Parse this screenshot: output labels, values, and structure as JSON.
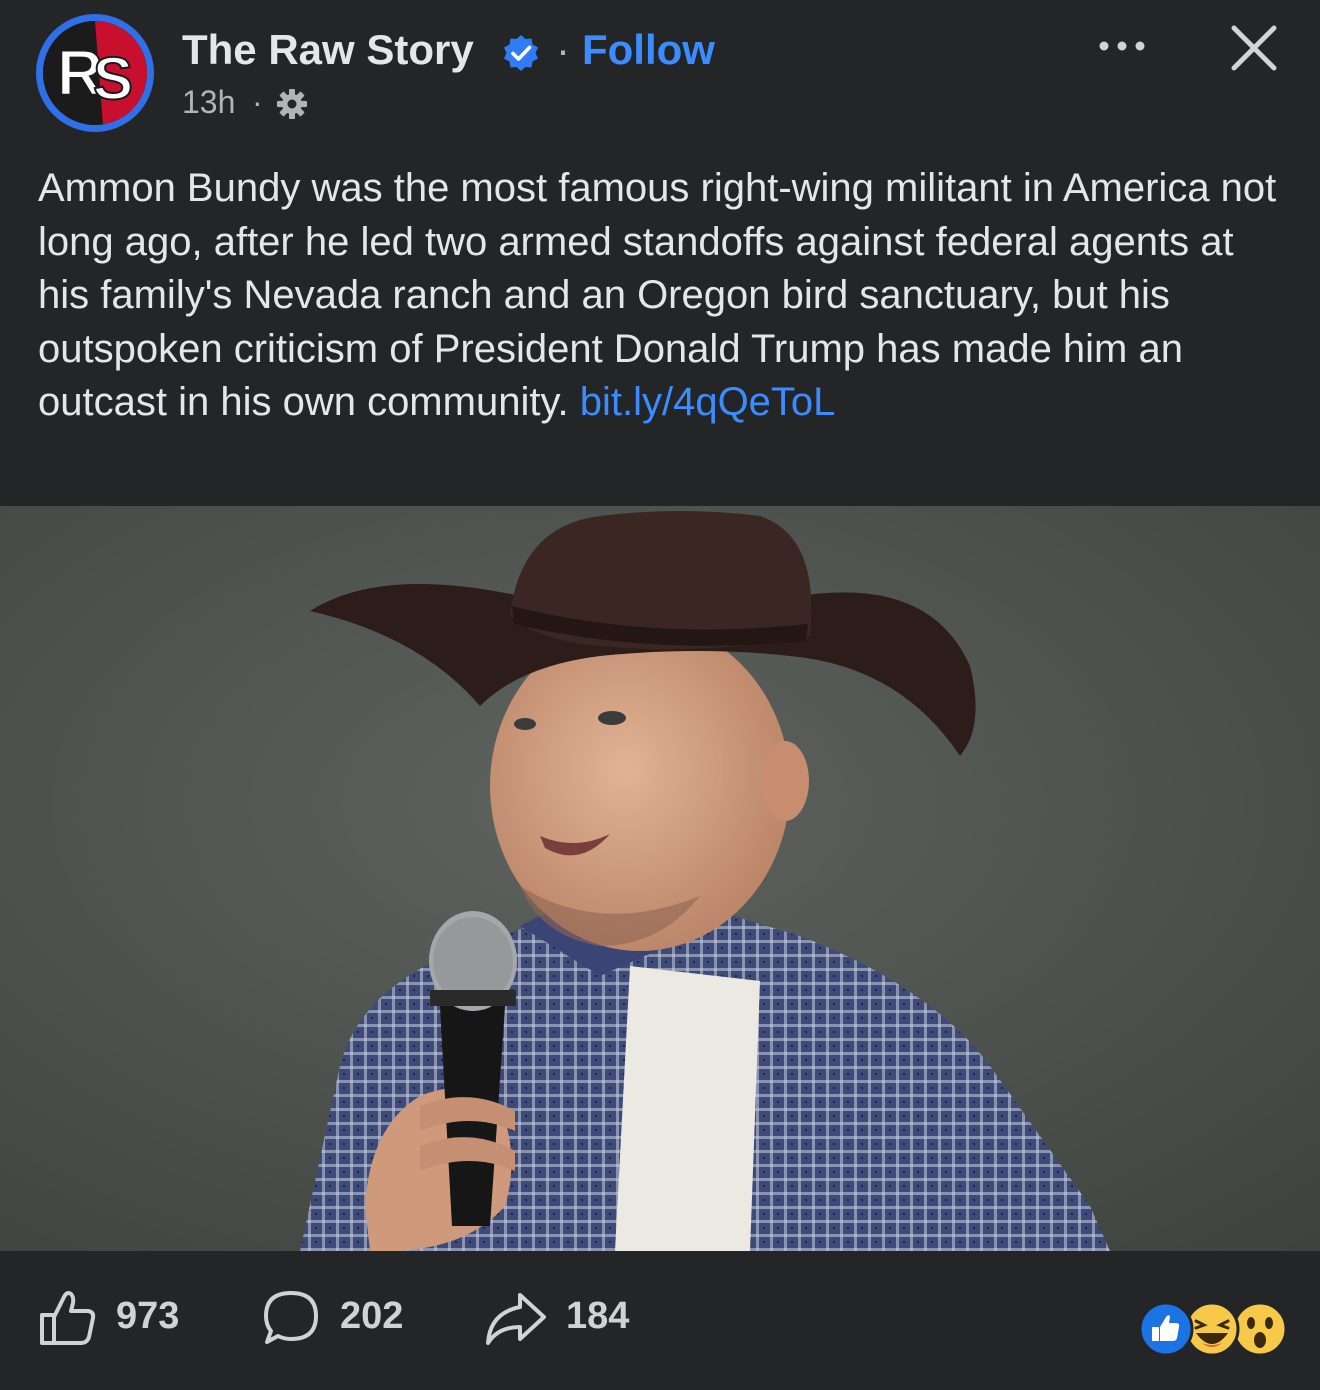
{
  "post": {
    "page_name": "The Raw Story",
    "separator": "·",
    "follow_label": "Follow",
    "timestamp": "13h",
    "timestamp_separator": "·",
    "text": "Ammon Bundy was the most famous right-wing militant in America not long ago, after he led two armed standoffs against federal agents at his family's Nevada ranch and an Oregon bird sanctuary, but his outspoken criticism of President Donald Trump has made him an outcast in his own community.",
    "link": "bit.ly/4qQeToL"
  },
  "avatar": {
    "logo_text": "RS"
  },
  "icons": {
    "verified": "verified-badge-icon",
    "audience": "gear-icon",
    "more": "more-dots-icon",
    "close": "close-icon",
    "like": "thumbs-up-icon",
    "comment": "comment-bubble-icon",
    "share": "share-arrow-icon"
  },
  "engagement": {
    "likes": "973",
    "comments": "202",
    "shares": "184",
    "reaction_types": [
      "like",
      "haha",
      "wow"
    ]
  },
  "colors": {
    "background": "#242526",
    "text": "#e4e6eb",
    "secondary_text": "#b0b3b8",
    "link": "#3b8dff",
    "verified_badge": "#2f7cf6",
    "avatar_ring": "#2f6fe8"
  }
}
